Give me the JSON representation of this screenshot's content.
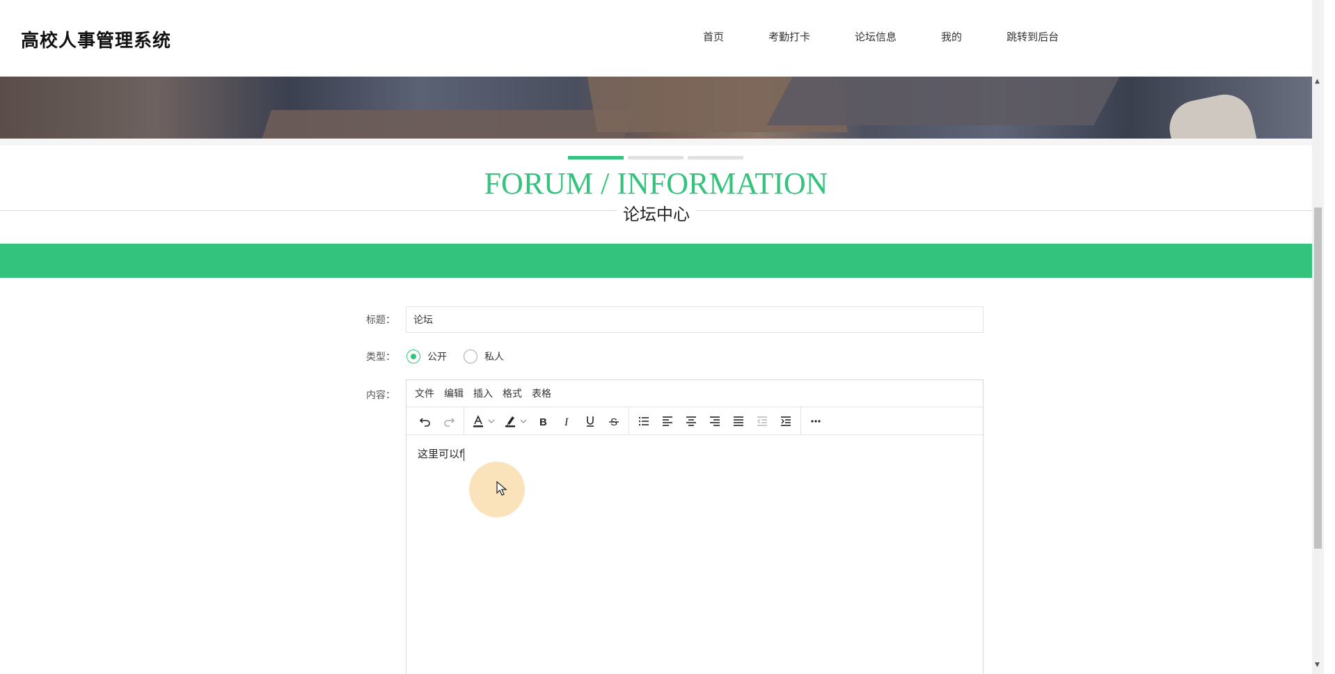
{
  "header": {
    "brand": "高校人事管理系统",
    "nav": [
      "首页",
      "考勤打卡",
      "论坛信息",
      "我的",
      "跳转到后台"
    ]
  },
  "section": {
    "title_en": "FORUM / INFORMATION",
    "title_cn": "论坛中心"
  },
  "form": {
    "title_label": "标题：",
    "title_value": "论坛",
    "type_label": "类型：",
    "type_options": [
      "公开",
      "私人"
    ],
    "type_selected": "公开",
    "content_label": "内容："
  },
  "editor": {
    "menus": [
      "文件",
      "编辑",
      "插入",
      "格式",
      "表格"
    ],
    "toolbar_icons": [
      "undo-icon",
      "redo-icon",
      "font-color-icon",
      "highlight-icon",
      "bold-icon",
      "italic-icon",
      "underline-icon",
      "strikethrough-icon",
      "list-icon",
      "align-left-icon",
      "align-center-icon",
      "align-right-icon",
      "justify-icon",
      "outdent-icon",
      "indent-icon",
      "more-icon"
    ],
    "content": "这里可以f"
  },
  "colors": {
    "accent": "#34c37d"
  }
}
